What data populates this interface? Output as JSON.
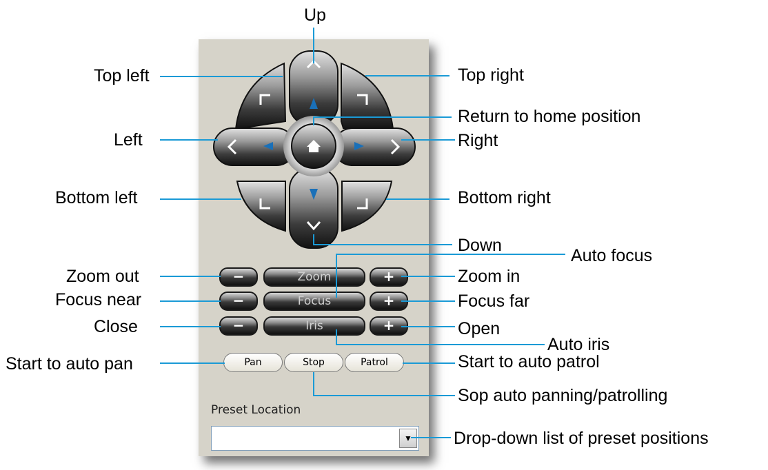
{
  "labels": {
    "up": "Up",
    "top_left": "Top left",
    "top_right": "Top right",
    "return_home": "Return to home position",
    "left": "Left",
    "right": "Right",
    "bottom_left": "Bottom left",
    "bottom_right": "Bottom right",
    "down": "Down",
    "auto_focus": "Auto focus",
    "zoom_out": "Zoom out",
    "zoom_in": "Zoom in",
    "focus_near": "Focus near",
    "focus_far": "Focus far",
    "close": "Close",
    "open": "Open",
    "auto_iris": "Auto iris",
    "start_auto_pan": "Start to auto pan",
    "start_auto_patrol": "Start to auto patrol",
    "stop_auto": "Sop auto panning/patrolling",
    "dropdown_desc": "Drop-down list of preset positions"
  },
  "controls": {
    "zoom": "Zoom",
    "focus": "Focus",
    "iris": "Iris",
    "minus": "−",
    "plus": "+",
    "pan": "Pan",
    "stop": "Stop",
    "patrol": "Patrol"
  },
  "preset": {
    "label": "Preset Location",
    "value": ""
  },
  "colors": {
    "leader_line": "#1a9ad6",
    "panel_bg": "#d6d3c9"
  }
}
